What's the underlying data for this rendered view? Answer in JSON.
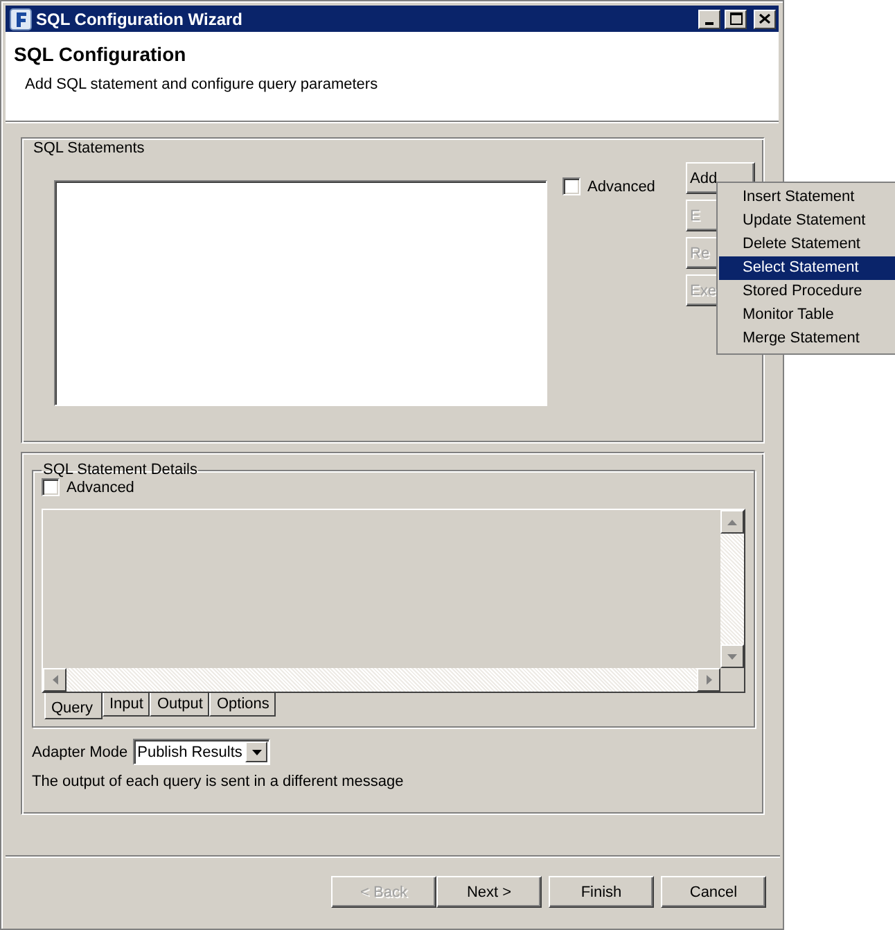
{
  "window": {
    "title": "SQL Configuration Wizard"
  },
  "header": {
    "title": "SQL Configuration",
    "subtitle": "Add SQL statement and configure query parameters"
  },
  "sql_statements": {
    "label": "SQL Statements",
    "advanced": {
      "label": "Advanced",
      "checked": false
    },
    "buttons": [
      {
        "label": "Add",
        "disabled": false
      },
      {
        "label": "E",
        "disabled": true
      },
      {
        "label": "Re",
        "disabled": true
      },
      {
        "label": "Exe",
        "disabled": true
      }
    ]
  },
  "add_menu": {
    "items": [
      {
        "label": "Insert Statement",
        "selected": false
      },
      {
        "label": "Update Statement",
        "selected": false
      },
      {
        "label": "Delete Statement",
        "selected": false
      },
      {
        "label": "Select Statement",
        "selected": true
      },
      {
        "label": "Stored Procedure",
        "selected": false
      },
      {
        "label": "Monitor Table",
        "selected": false
      },
      {
        "label": "Merge Statement",
        "selected": false
      }
    ]
  },
  "details": {
    "label": "SQL Statement Details",
    "advanced": {
      "label": "Advanced",
      "checked": false
    },
    "tabs": [
      {
        "label": "Query",
        "selected": true
      },
      {
        "label": "Input",
        "selected": false
      },
      {
        "label": "Output",
        "selected": false
      },
      {
        "label": "Options",
        "selected": false
      }
    ]
  },
  "adapter_mode": {
    "label": "Adapter Mode",
    "value": "Publish Results"
  },
  "message": "The output of each query is sent in a different message",
  "nav_buttons": [
    {
      "label": "< Back",
      "disabled": true
    },
    {
      "label": "Next >",
      "disabled": false
    },
    {
      "label": "Finish",
      "disabled": false
    },
    {
      "label": "Cancel",
      "disabled": false
    }
  ]
}
